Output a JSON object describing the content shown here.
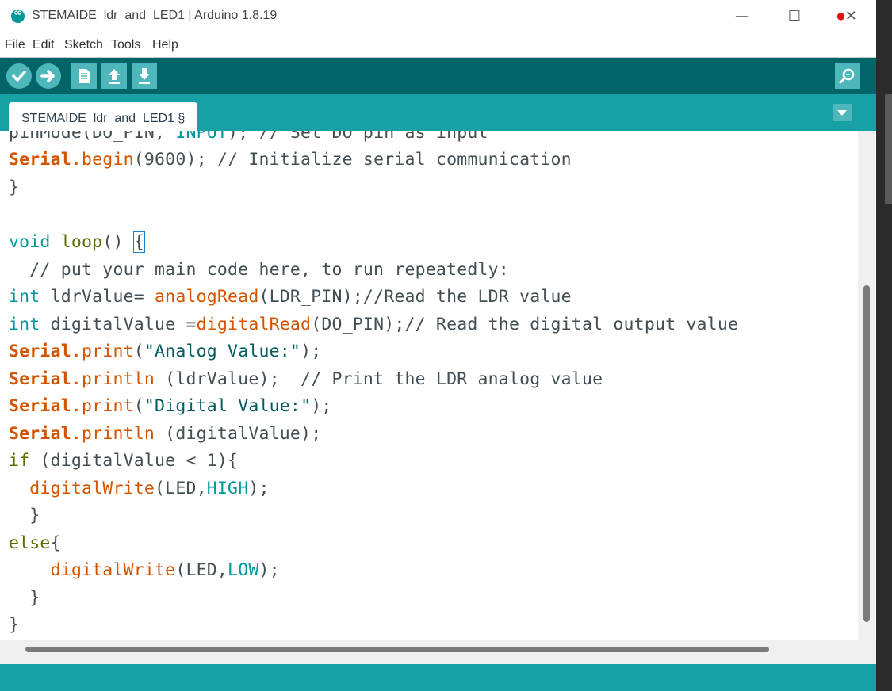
{
  "window": {
    "title": "STEMAIDE_ldr_and_LED1 | Arduino 1.8.19"
  },
  "menu": [
    "File",
    "Edit",
    "Sketch",
    "Tools",
    "Help"
  ],
  "toolbar": {
    "buttons": [
      "verify-icon",
      "upload-icon",
      "new-icon",
      "open-icon",
      "save-icon"
    ],
    "serial_monitor": "serial-monitor-icon"
  },
  "tab": {
    "label": "STEMAIDE_ldr_and_LED1 §"
  },
  "code": {
    "line0": {
      "a": "pinMode(DO_PIN, ",
      "b": "INPUT",
      "c": "); // Set DO pin as input"
    },
    "line1": {
      "obj": "Serial",
      "fn": ".begin",
      "rest": "(9600); // Initialize serial communication"
    },
    "line2": "}",
    "line4": {
      "kw": "void",
      "fn": " loop",
      "rest": "() ",
      "brace": "{"
    },
    "line5": "  // put your main code here, to run repeatedly:",
    "line6": {
      "kw": "int",
      "mid": " ldrValue= ",
      "fn": "analogRead",
      "rest": "(LDR_PIN);//Read the LDR value"
    },
    "line7": {
      "kw": "int",
      "mid": " digitalValue =",
      "fn": "digitalRead",
      "rest": "(DO_PIN);// Read the digital output value"
    },
    "line8": {
      "obj": "Serial",
      "fn": ".print",
      "p1": "(",
      "str": "\"Analog Value:\"",
      "p2": ");"
    },
    "line9": {
      "obj": "Serial",
      "fn": ".println",
      "rest": " (ldrValue);  // Print the LDR analog value"
    },
    "line10": {
      "obj": "Serial",
      "fn": ".print",
      "p1": "(",
      "str": "\"Digital Value:\"",
      "p2": ");"
    },
    "line11": {
      "obj": "Serial",
      "fn": ".println",
      "rest": " (digitalValue);"
    },
    "line12": {
      "kw": "if",
      "rest": " (digitalValue < 1){"
    },
    "line13": {
      "indent": "  ",
      "fn": "digitalWrite",
      "p1": "(LED,",
      "const": "HIGH",
      "p2": ");"
    },
    "line14": "  }",
    "line15": {
      "kw": "else",
      "rest": "{"
    },
    "line16": {
      "indent": "    ",
      "fn": "digitalWrite",
      "p1": "(LED,",
      "const": "LOW",
      "p2": ");"
    },
    "line17": "  }",
    "line18": "}"
  },
  "colors": {
    "toolbar": "#006468",
    "tabbar": "#17a1a5",
    "button": "#4db7bb",
    "keyword_type": "#00979c",
    "function": "#d35400",
    "string": "#005c5f"
  }
}
